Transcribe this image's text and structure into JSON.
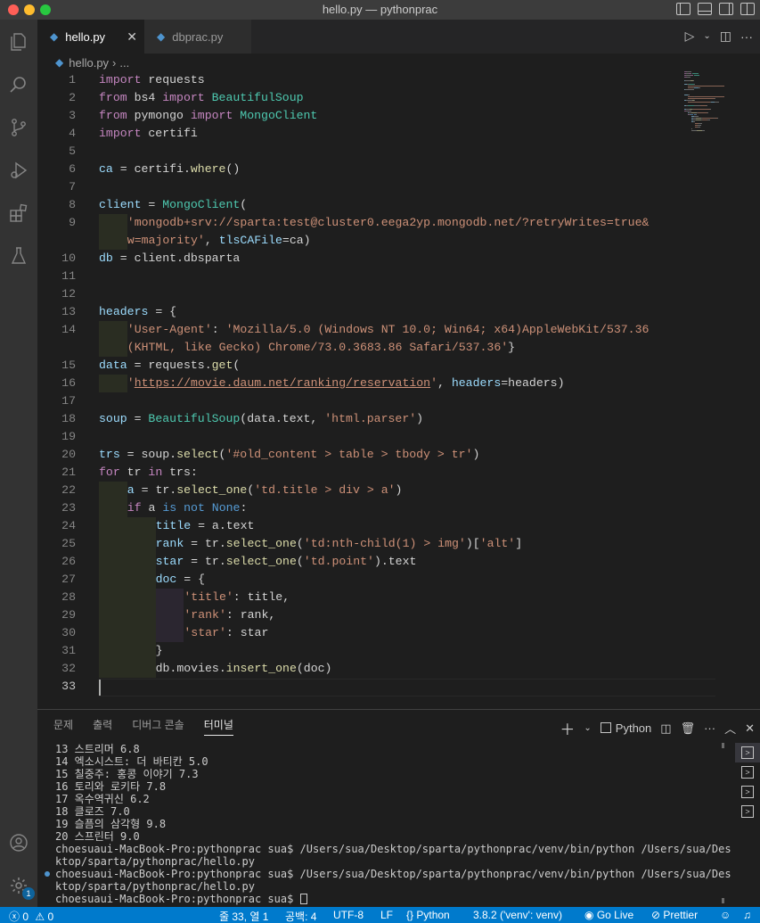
{
  "window": {
    "title": "hello.py — pythonprac"
  },
  "tabs": [
    {
      "label": "hello.py",
      "active": true
    },
    {
      "label": "dbprac.py",
      "active": false
    }
  ],
  "breadcrumb": {
    "file": "hello.py",
    "sep": "›",
    "more": "..."
  },
  "editor": {
    "current_line": 33,
    "lines": [
      {
        "n": "1",
        "s": [
          [
            "kw",
            "import"
          ],
          [
            "p",
            " requests"
          ]
        ]
      },
      {
        "n": "2",
        "s": [
          [
            "kw",
            "from"
          ],
          [
            "p",
            " bs4 "
          ],
          [
            "kw",
            "import"
          ],
          [
            "p",
            " "
          ],
          [
            "cls",
            "BeautifulSoup"
          ]
        ]
      },
      {
        "n": "3",
        "s": [
          [
            "kw",
            "from"
          ],
          [
            "p",
            " pymongo "
          ],
          [
            "kw",
            "import"
          ],
          [
            "p",
            " "
          ],
          [
            "cls",
            "MongoClient"
          ]
        ]
      },
      {
        "n": "4",
        "s": [
          [
            "kw",
            "import"
          ],
          [
            "p",
            " certifi"
          ]
        ]
      },
      {
        "n": "5",
        "s": []
      },
      {
        "n": "6",
        "s": [
          [
            "var",
            "ca"
          ],
          [
            "p",
            " = certifi."
          ],
          [
            "fn",
            "where"
          ],
          [
            "p",
            "()"
          ]
        ]
      },
      {
        "n": "7",
        "s": []
      },
      {
        "n": "8",
        "s": [
          [
            "var",
            "client"
          ],
          [
            "p",
            " = "
          ],
          [
            "cls",
            "MongoClient"
          ],
          [
            "p",
            "("
          ]
        ]
      },
      {
        "n": "9",
        "i": 1,
        "s": [
          [
            "str",
            "'mongodb+srv://sparta:test@cluster0.eega2yp.mongodb.net/?retryWrites=true&"
          ]
        ]
      },
      {
        "n": "",
        "i": 1,
        "s": [
          [
            "str",
            "w=majority'"
          ],
          [
            "p",
            ", "
          ],
          [
            "var",
            "tlsCAFile"
          ],
          [
            "p",
            "=ca)"
          ]
        ]
      },
      {
        "n": "10",
        "s": [
          [
            "var",
            "db"
          ],
          [
            "p",
            " = client.dbsparta"
          ]
        ]
      },
      {
        "n": "11",
        "s": []
      },
      {
        "n": "12",
        "s": []
      },
      {
        "n": "13",
        "s": [
          [
            "var",
            "headers"
          ],
          [
            "p",
            " = {"
          ]
        ]
      },
      {
        "n": "14",
        "i": 1,
        "s": [
          [
            "str",
            "'User-Agent'"
          ],
          [
            "p",
            ": "
          ],
          [
            "str",
            "'Mozilla/5.0 (Windows NT 10.0; Win64; x64)AppleWebKit/537.36"
          ]
        ]
      },
      {
        "n": "",
        "i": 1,
        "s": [
          [
            "str",
            "(KHTML, like Gecko) Chrome/73.0.3683.86 Safari/537.36'"
          ],
          [
            "p",
            "}"
          ]
        ]
      },
      {
        "n": "15",
        "s": [
          [
            "var",
            "data"
          ],
          [
            "p",
            " = requests."
          ],
          [
            "fn",
            "get"
          ],
          [
            "p",
            "("
          ]
        ]
      },
      {
        "n": "16",
        "i": 1,
        "s": [
          [
            "str",
            "'"
          ],
          [
            "stru",
            "https://movie.daum.net/ranking/reservation"
          ],
          [
            "str",
            "'"
          ],
          [
            "p",
            ", "
          ],
          [
            "var",
            "headers"
          ],
          [
            "p",
            "=headers)"
          ]
        ]
      },
      {
        "n": "17",
        "s": []
      },
      {
        "n": "18",
        "s": [
          [
            "var",
            "soup"
          ],
          [
            "p",
            " = "
          ],
          [
            "cls",
            "BeautifulSoup"
          ],
          [
            "p",
            "(data.text, "
          ],
          [
            "str",
            "'html.parser'"
          ],
          [
            "p",
            ")"
          ]
        ]
      },
      {
        "n": "19",
        "s": []
      },
      {
        "n": "20",
        "s": [
          [
            "var",
            "trs"
          ],
          [
            "p",
            " = soup."
          ],
          [
            "fn",
            "select"
          ],
          [
            "p",
            "("
          ],
          [
            "str",
            "'#old_content > table > tbody > tr'"
          ],
          [
            "p",
            ")"
          ]
        ]
      },
      {
        "n": "21",
        "s": [
          [
            "kw",
            "for"
          ],
          [
            "p",
            " tr "
          ],
          [
            "kw",
            "in"
          ],
          [
            "p",
            " trs:"
          ]
        ]
      },
      {
        "n": "22",
        "i": 1,
        "s": [
          [
            "var",
            "a"
          ],
          [
            "p",
            " = tr."
          ],
          [
            "fn",
            "select_one"
          ],
          [
            "p",
            "("
          ],
          [
            "str",
            "'td.title > div > a'"
          ],
          [
            "p",
            ")"
          ]
        ]
      },
      {
        "n": "23",
        "i": 1,
        "s": [
          [
            "kw",
            "if"
          ],
          [
            "p",
            " a "
          ],
          [
            "kb",
            "is not"
          ],
          [
            "p",
            " "
          ],
          [
            "kb",
            "None"
          ],
          [
            "p",
            ":"
          ]
        ]
      },
      {
        "n": "24",
        "i": 2,
        "s": [
          [
            "var",
            "title"
          ],
          [
            "p",
            " = a.text"
          ]
        ]
      },
      {
        "n": "25",
        "i": 2,
        "s": [
          [
            "var",
            "rank"
          ],
          [
            "p",
            " = tr."
          ],
          [
            "fn",
            "select_one"
          ],
          [
            "p",
            "("
          ],
          [
            "str",
            "'td:nth-child(1) > img'"
          ],
          [
            "p",
            ")["
          ],
          [
            "str",
            "'alt'"
          ],
          [
            "p",
            "]"
          ]
        ]
      },
      {
        "n": "26",
        "i": 2,
        "s": [
          [
            "var",
            "star"
          ],
          [
            "p",
            " = tr."
          ],
          [
            "fn",
            "select_one"
          ],
          [
            "p",
            "("
          ],
          [
            "str",
            "'td.point'"
          ],
          [
            "p",
            ").text"
          ]
        ]
      },
      {
        "n": "27",
        "i": 2,
        "s": [
          [
            "var",
            "doc"
          ],
          [
            "p",
            " = {"
          ]
        ]
      },
      {
        "n": "28",
        "i": 3,
        "s": [
          [
            "str",
            "'title'"
          ],
          [
            "p",
            ": title,"
          ]
        ]
      },
      {
        "n": "29",
        "i": 3,
        "s": [
          [
            "str",
            "'rank'"
          ],
          [
            "p",
            ": rank,"
          ]
        ]
      },
      {
        "n": "30",
        "i": 3,
        "s": [
          [
            "str",
            "'star'"
          ],
          [
            "p",
            ": star"
          ]
        ]
      },
      {
        "n": "31",
        "i": 2,
        "s": [
          [
            "p",
            "}"
          ]
        ]
      },
      {
        "n": "32",
        "i": 2,
        "s": [
          [
            "p",
            "db.movies."
          ],
          [
            "fn",
            "insert_one"
          ],
          [
            "p",
            "(doc)"
          ]
        ]
      },
      {
        "n": "33",
        "s": []
      }
    ]
  },
  "panel": {
    "tabs": [
      "문제",
      "출력",
      "디버그 콘솔",
      "터미널"
    ],
    "active_tab": "터미널",
    "terminal_name": "Python",
    "terminal_lines": [
      "13 스트리머 6.8",
      "14 엑소시스트: 더 바티칸 5.0",
      "15 칠중주: 홍콩 이야기 7.3",
      "16 토리와 로키타 7.8",
      "17 옥수역귀신 6.2",
      "18 클로즈 7.0",
      "19 슬픔의 삼각형 9.8",
      "20 스프린터 9.0",
      "choesuaui-MacBook-Pro:pythonprac sua$ /Users/sua/Desktop/sparta/pythonprac/venv/bin/python /Users/sua/Des",
      "ktop/sparta/pythonprac/hello.py",
      "choesuaui-MacBook-Pro:pythonprac sua$ /Users/sua/Desktop/sparta/pythonprac/venv/bin/python /Users/sua/Des",
      "ktop/sparta/pythonprac/hello.py",
      "choesuaui-MacBook-Pro:pythonprac sua$ "
    ]
  },
  "statusbar": {
    "errors": "0",
    "warnings": "0",
    "position": "줄 33, 열 1",
    "spaces": "공백: 4",
    "encoding": "UTF-8",
    "eol": "LF",
    "language": "Python",
    "interpreter": "3.8.2 ('venv': venv)",
    "golive": "Go Live",
    "prettier": "Prettier"
  },
  "activity": {
    "settings_badge": "1"
  },
  "colors": {
    "accent": "#007acc",
    "keyword": "#c586c0",
    "string": "#ce9178",
    "function": "#dcdcaa",
    "class": "#4ec9b0",
    "variable": "#9cdcfe"
  }
}
